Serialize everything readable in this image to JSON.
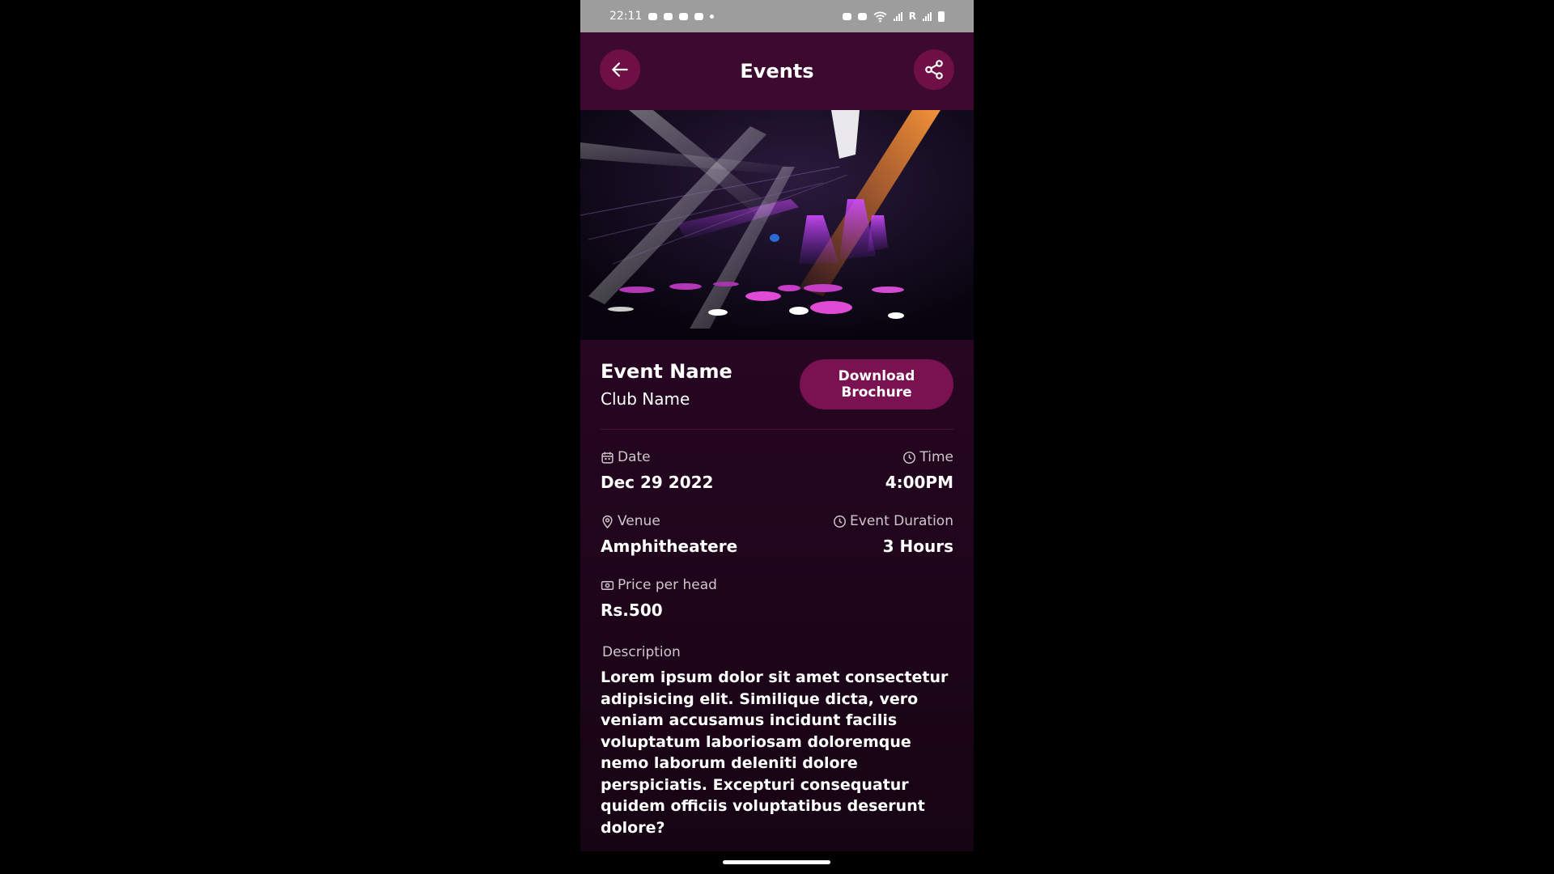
{
  "status_bar": {
    "time": "22:11",
    "network_label": "R"
  },
  "header": {
    "title": "Events",
    "back_icon": "arrow-left-icon",
    "share_icon": "share-icon"
  },
  "event": {
    "name": "Event Name",
    "club": "Club Name",
    "download_label": "Download Brochure"
  },
  "details": {
    "date_label": "Date",
    "date_value": "Dec 29 2022",
    "time_label": "Time",
    "time_value": "4:00PM",
    "venue_label": "Venue",
    "venue_value": "Amphitheatere",
    "duration_label": "Event Duration",
    "duration_value": "3 Hours",
    "price_label": "Price per head",
    "price_value": "Rs.500"
  },
  "description": {
    "label": "Description",
    "text": "Lorem ipsum dolor sit amet consectetur adipisicing elit. Similique dicta, vero veniam accusamus incidunt facilis voluptatum laboriosam doloremque nemo laborum deleniti dolore perspiciatis. Excepturi consequatur quidem officiis voluptatibus deserunt dolore?"
  },
  "colors": {
    "accent": "#7a1150",
    "header_bg": "#3b0a2e",
    "page_bg": "#250620"
  }
}
